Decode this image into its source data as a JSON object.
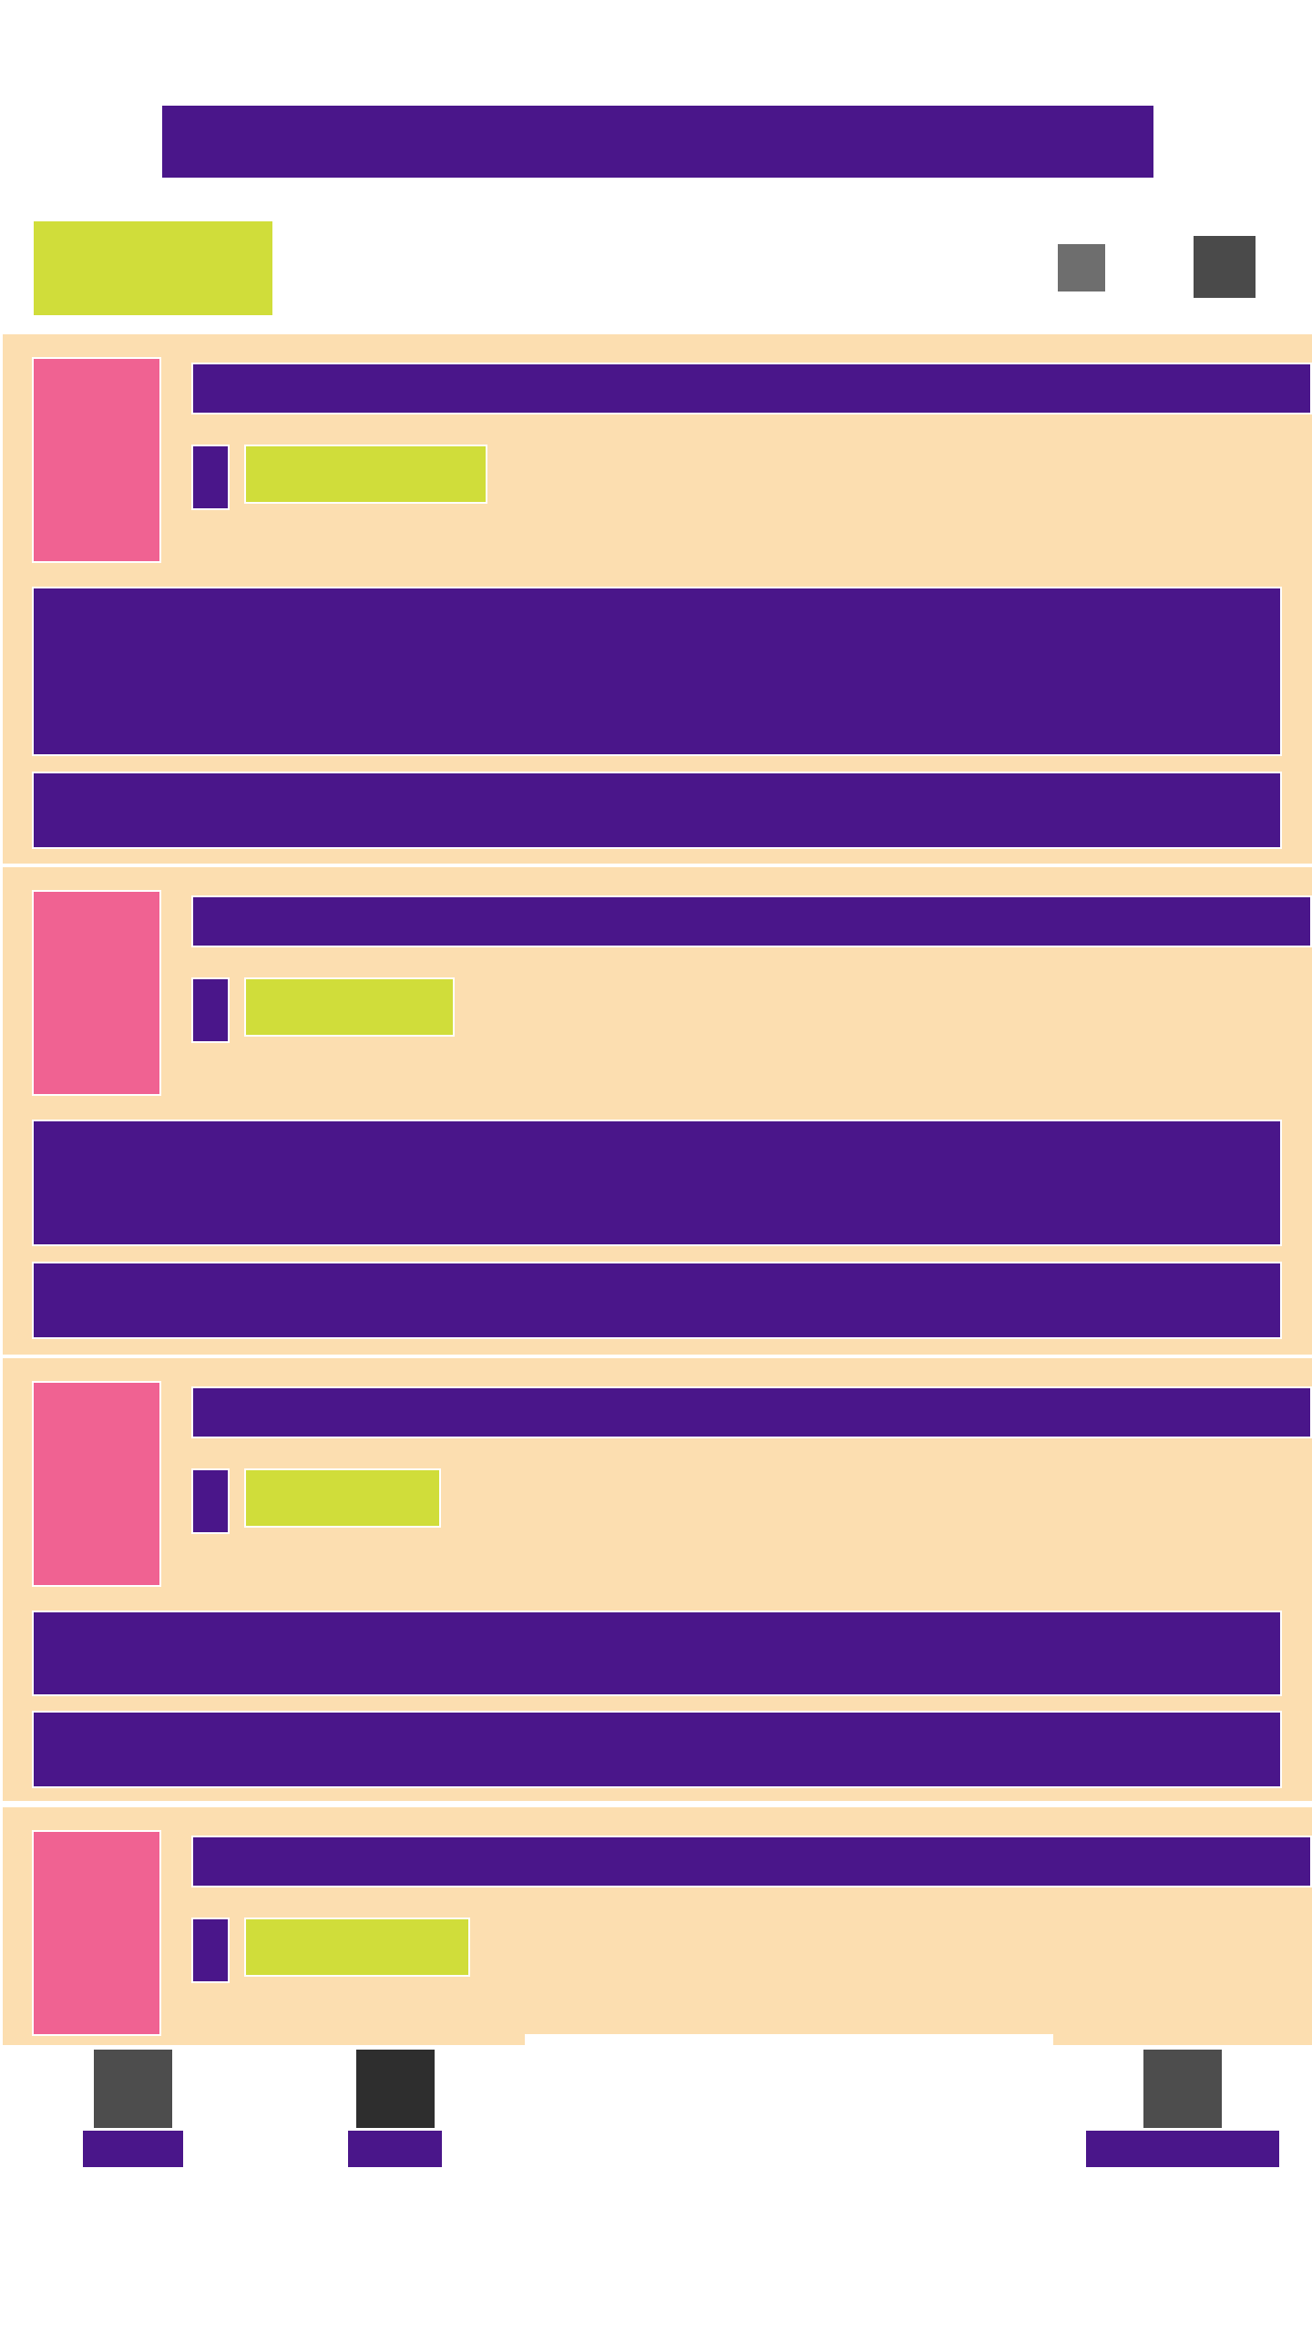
{
  "header": {
    "title": ""
  },
  "toolbar": {
    "filter_label": "",
    "icons": [
      "view-toggle-icon",
      "sort-icon"
    ]
  },
  "feed": {
    "items": [
      {
        "title": "",
        "meta_icon": "",
        "tag": "",
        "description": "",
        "action": ""
      },
      {
        "title": "",
        "meta_icon": "",
        "tag": "",
        "description": "",
        "action": ""
      },
      {
        "title": "",
        "meta_icon": "",
        "tag": "",
        "description": "",
        "action": ""
      },
      {
        "title": "",
        "meta_icon": "",
        "tag": ""
      }
    ]
  },
  "bottom_nav": {
    "items": [
      {
        "icon": "home-icon",
        "label": ""
      },
      {
        "icon": "explore-icon",
        "label": ""
      },
      {
        "icon": "profile-icon",
        "label": ""
      }
    ]
  },
  "colors": {
    "brand": "#4a168a",
    "accent": "#d0dd3a",
    "thumbnail": "#f06292",
    "card_background": "#fcdeb0",
    "icon_gray": "#4d4d4d",
    "icon_dark": "#2e2e2e"
  }
}
